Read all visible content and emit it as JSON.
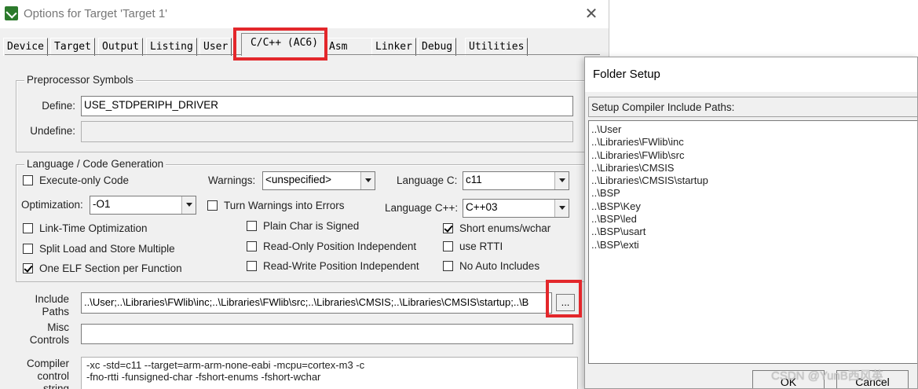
{
  "options_window": {
    "title": "Options for Target 'Target 1'",
    "close": "✕",
    "tabs": [
      "Device",
      "Target",
      "Output",
      "Listing",
      "User",
      "C/C++ (AC6)",
      "Asm",
      "Linker",
      "Debug",
      "Utilities"
    ],
    "active_tab": "C/C++ (AC6)",
    "preprocessor": {
      "title": "Preprocessor Symbols",
      "define_label": "Define:",
      "define_value": "USE_STDPERIPH_DRIVER",
      "undefine_label": "Undefine:",
      "undefine_value": ""
    },
    "language": {
      "title": "Language / Code Generation",
      "execute_only": {
        "label": "Execute-only Code",
        "checked": false
      },
      "warnings_label": "Warnings:",
      "warnings_value": "<unspecified>",
      "language_c_label": "Language C:",
      "language_c_value": "c11",
      "optimization_label": "Optimization:",
      "optimization_value": "-O1",
      "turn_warnings": {
        "label": "Turn Warnings into Errors",
        "checked": false
      },
      "language_cpp_label": "Language C++:",
      "language_cpp_value": "C++03",
      "link_time": {
        "label": "Link-Time Optimization",
        "checked": false
      },
      "plain_char": {
        "label": "Plain Char is Signed",
        "checked": false
      },
      "short_enums": {
        "label": "Short enums/wchar",
        "checked": true
      },
      "split_load": {
        "label": "Split Load and Store Multiple",
        "checked": false
      },
      "read_only": {
        "label": "Read-Only Position Independent",
        "checked": false
      },
      "use_rtti": {
        "label": "use RTTI",
        "checked": false
      },
      "one_elf": {
        "label": "One ELF Section per Function",
        "checked": true
      },
      "read_write": {
        "label": "Read-Write Position Independent",
        "checked": false
      },
      "no_auto": {
        "label": "No Auto Includes",
        "checked": false
      }
    },
    "include_paths_label_1": "Include",
    "include_paths_label_2": "Paths",
    "include_paths_value": "..\\User;..\\Libraries\\FWlib\\inc;..\\Libraries\\FWlib\\src;..\\Libraries\\CMSIS;..\\Libraries\\CMSIS\\startup;..\\B",
    "include_paths_button": "...",
    "misc_label_1": "Misc",
    "misc_label_2": "Controls",
    "misc_value": "",
    "compiler_label_1": "Compiler",
    "compiler_label_2": "control",
    "compiler_label_3": "string",
    "compiler_line_1": "-xc -std=c11 --target=arm-arm-none-eabi -mcpu=cortex-m3 -c",
    "compiler_line_2": "-fno-rtti -funsigned-char -fshort-enums -fshort-wchar"
  },
  "folder_setup": {
    "title": "Folder Setup",
    "list_label": "Setup Compiler Include Paths:",
    "paths": [
      "..\\User",
      "..\\Libraries\\FWlib\\inc",
      "..\\Libraries\\FWlib\\src",
      "..\\Libraries\\CMSIS",
      "..\\Libraries\\CMSIS\\startup",
      "..\\BSP",
      "..\\BSP\\Key",
      "..\\BSP\\led",
      "..\\BSP\\usart",
      "..\\BSP\\exti"
    ],
    "ok_label": "OK",
    "cancel_label": "Cancel"
  },
  "watermark": "CSDN @YunB西风英",
  "colors": {
    "highlight": "#e3272b",
    "window_bg": "#f0f0f0"
  }
}
